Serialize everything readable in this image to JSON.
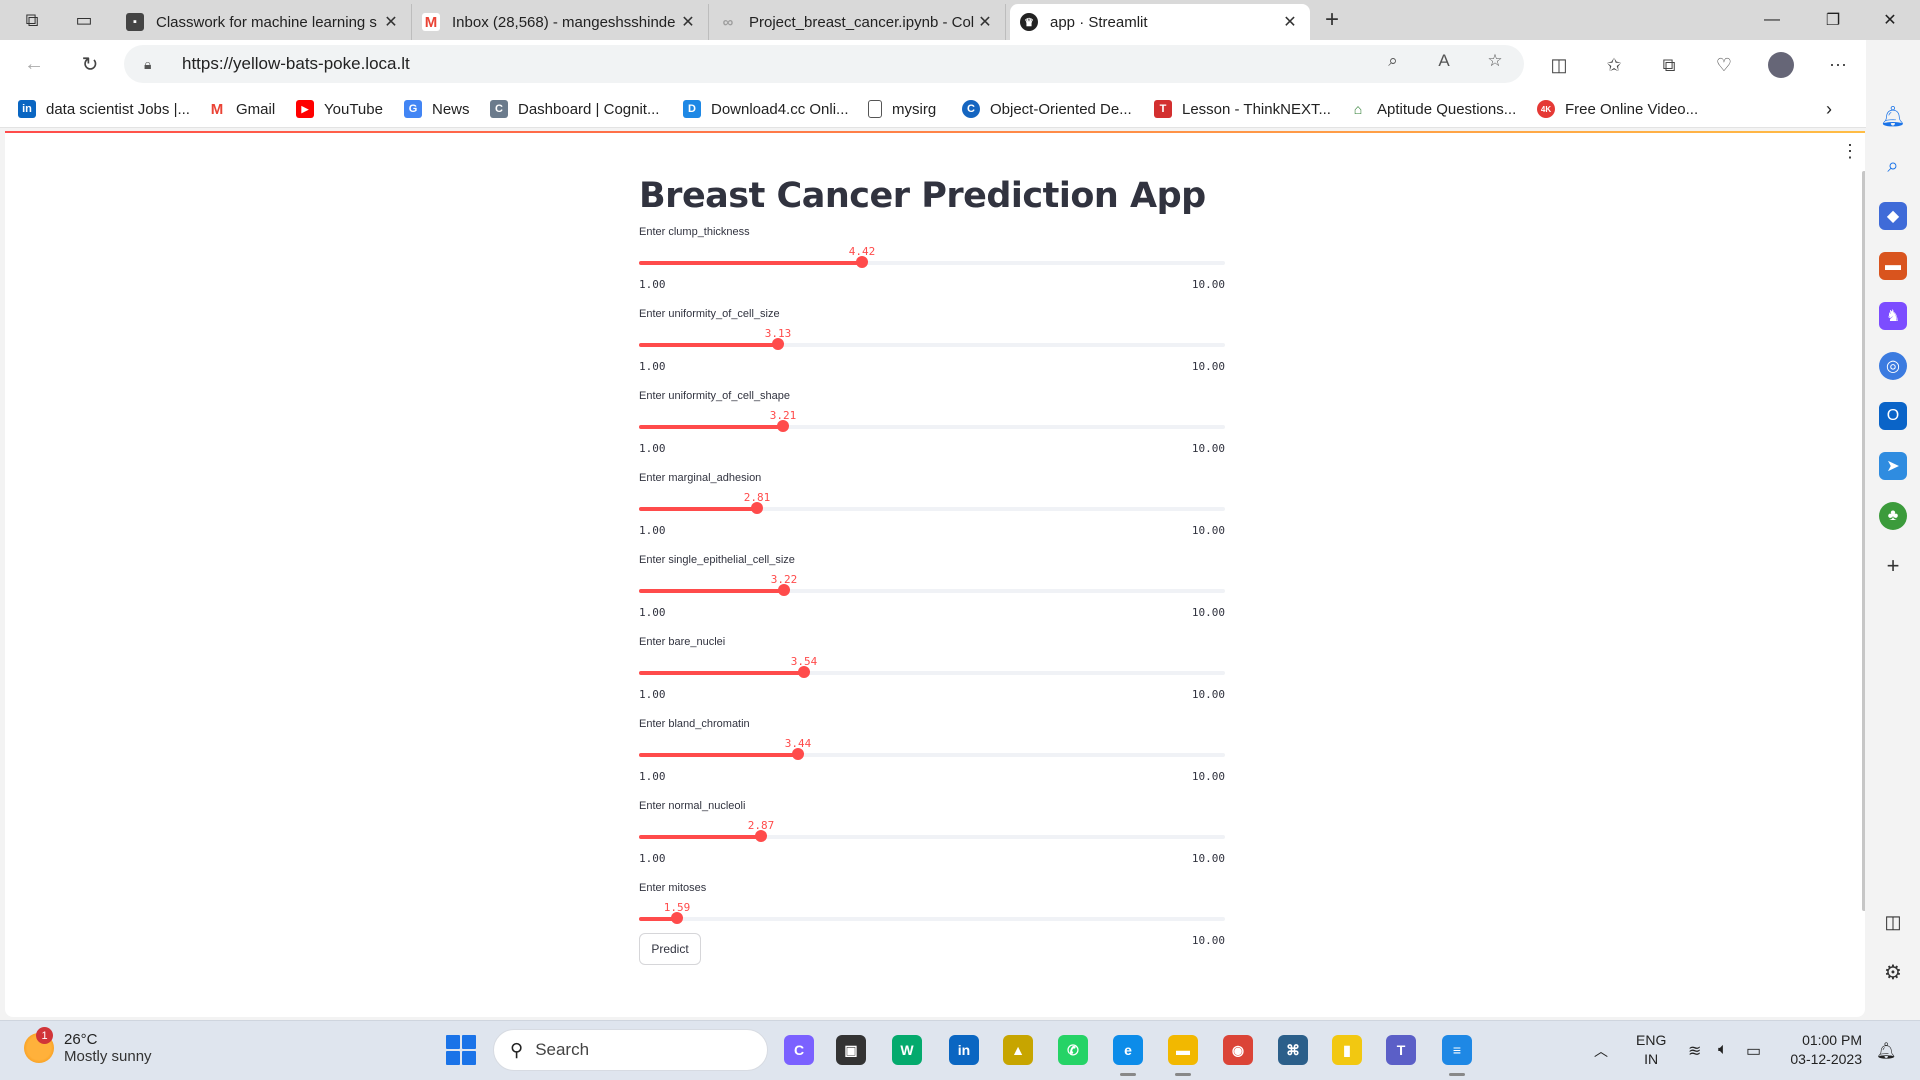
{
  "browser": {
    "tabs": [
      {
        "title": "Classwork for machine learning s",
        "icon": "classroom-icon",
        "color": "#444444"
      },
      {
        "title": "Inbox (28,568) - mangeshsshinde",
        "icon": "gmail-icon",
        "color": "#ea4335"
      },
      {
        "title": "Project_breast_cancer.ipynb - Col",
        "icon": "colab-icon",
        "color": "#9e9e9e"
      },
      {
        "title": "app · Streamlit",
        "icon": "streamlit-icon",
        "color": "#222222"
      }
    ],
    "url": "https://yellow-bats-poke.loca.lt",
    "bookmarks": [
      {
        "label": "data scientist Jobs |...",
        "icon": "linkedin-icon",
        "color": "#0a66c2",
        "glyph": "in"
      },
      {
        "label": "Gmail",
        "icon": "gmail-icon",
        "color": "#ea4335",
        "glyph": "M"
      },
      {
        "label": "YouTube",
        "icon": "youtube-icon",
        "color": "#ff0000",
        "glyph": "▶"
      },
      {
        "label": "News",
        "icon": "news-icon",
        "color": "#4285f4",
        "glyph": "G"
      },
      {
        "label": "Dashboard | Cognit...",
        "icon": "cognitive-icon",
        "color": "#6b7b8c",
        "glyph": "C"
      },
      {
        "label": "Download4.cc Onli...",
        "icon": "download-icon",
        "color": "#1e88e5",
        "glyph": "D"
      },
      {
        "label": "mysirg",
        "icon": "page-icon",
        "color": "#ffffff",
        "glyph": "▯"
      },
      {
        "label": "Object-Oriented De...",
        "icon": "object-oriented-icon",
        "color": "#1565c0",
        "glyph": "C"
      },
      {
        "label": "Lesson - ThinkNEXT...",
        "icon": "thinknext-icon",
        "color": "#d32f2f",
        "glyph": "T"
      },
      {
        "label": "Aptitude Questions...",
        "icon": "aptitude-icon",
        "color": "#2e7d32",
        "glyph": "⌂"
      },
      {
        "label": "Free Online Video...",
        "icon": "video-icon",
        "color": "#e53935",
        "glyph": "4K"
      }
    ]
  },
  "app": {
    "title": "Breast Cancer Prediction App",
    "sliders": [
      {
        "label": "Enter clump_thickness",
        "value": 4.42,
        "value_text": "4.42",
        "min": 1,
        "max": 10,
        "min_text": "1.00",
        "max_text": "10.00"
      },
      {
        "label": "Enter uniformity_of_cell_size",
        "value": 3.13,
        "value_text": "3.13",
        "min": 1,
        "max": 10,
        "min_text": "1.00",
        "max_text": "10.00"
      },
      {
        "label": "Enter uniformity_of_cell_shape",
        "value": 3.21,
        "value_text": "3.21",
        "min": 1,
        "max": 10,
        "min_text": "1.00",
        "max_text": "10.00"
      },
      {
        "label": "Enter marginal_adhesion",
        "value": 2.81,
        "value_text": "2.81",
        "min": 1,
        "max": 10,
        "min_text": "1.00",
        "max_text": "10.00"
      },
      {
        "label": "Enter single_epithelial_cell_size",
        "value": 3.22,
        "value_text": "3.22",
        "min": 1,
        "max": 10,
        "min_text": "1.00",
        "max_text": "10.00"
      },
      {
        "label": "Enter bare_nuclei",
        "value": 3.54,
        "value_text": "3.54",
        "min": 1,
        "max": 10,
        "min_text": "1.00",
        "max_text": "10.00"
      },
      {
        "label": "Enter bland_chromatin",
        "value": 3.44,
        "value_text": "3.44",
        "min": 1,
        "max": 10,
        "min_text": "1.00",
        "max_text": "10.00"
      },
      {
        "label": "Enter normal_nucleoli",
        "value": 2.87,
        "value_text": "2.87",
        "min": 1,
        "max": 10,
        "min_text": "1.00",
        "max_text": "10.00"
      },
      {
        "label": "Enter mitoses",
        "value": 1.59,
        "value_text": "1.59",
        "min": 1,
        "max": 10,
        "min_text": "1.00",
        "max_text": "10.00"
      }
    ],
    "predict_label": "Predict",
    "accent_color": "#ff4b4b"
  },
  "taskbar": {
    "weather": {
      "temp": "26°C",
      "desc": "Mostly sunny",
      "badge": "1"
    },
    "search_placeholder": "Search",
    "apps": [
      {
        "name": "copilot-icon",
        "color": "#7b61ff",
        "glyph": "C"
      },
      {
        "name": "task-view-icon",
        "color": "#333333",
        "glyph": "▣"
      },
      {
        "name": "w3schools-icon",
        "color": "#04aa6d",
        "glyph": "W"
      },
      {
        "name": "linkedin-icon",
        "color": "#0a66c2",
        "glyph": "in"
      },
      {
        "name": "photos-icon",
        "color": "#c7a500",
        "glyph": "▲"
      },
      {
        "name": "whatsapp-icon",
        "color": "#25d366",
        "glyph": "✆"
      },
      {
        "name": "edge-icon",
        "color": "#0c8ce9",
        "glyph": "e"
      },
      {
        "name": "file-explorer-icon",
        "color": "#f2b800",
        "glyph": "▬"
      },
      {
        "name": "chrome-icon",
        "color": "#db4437",
        "glyph": "◉"
      },
      {
        "name": "mysql-workbench-icon",
        "color": "#2b5f8a",
        "glyph": "⌘"
      },
      {
        "name": "power-bi-icon",
        "color": "#f2c811",
        "glyph": "▮"
      },
      {
        "name": "teams-icon",
        "color": "#5b5fc7",
        "glyph": "T"
      },
      {
        "name": "notepad-icon",
        "color": "#1e88e5",
        "glyph": "≡"
      }
    ],
    "lang_1": "ENG",
    "lang_2": "IN",
    "time": "01:00 PM",
    "date": "03-12-2023"
  }
}
